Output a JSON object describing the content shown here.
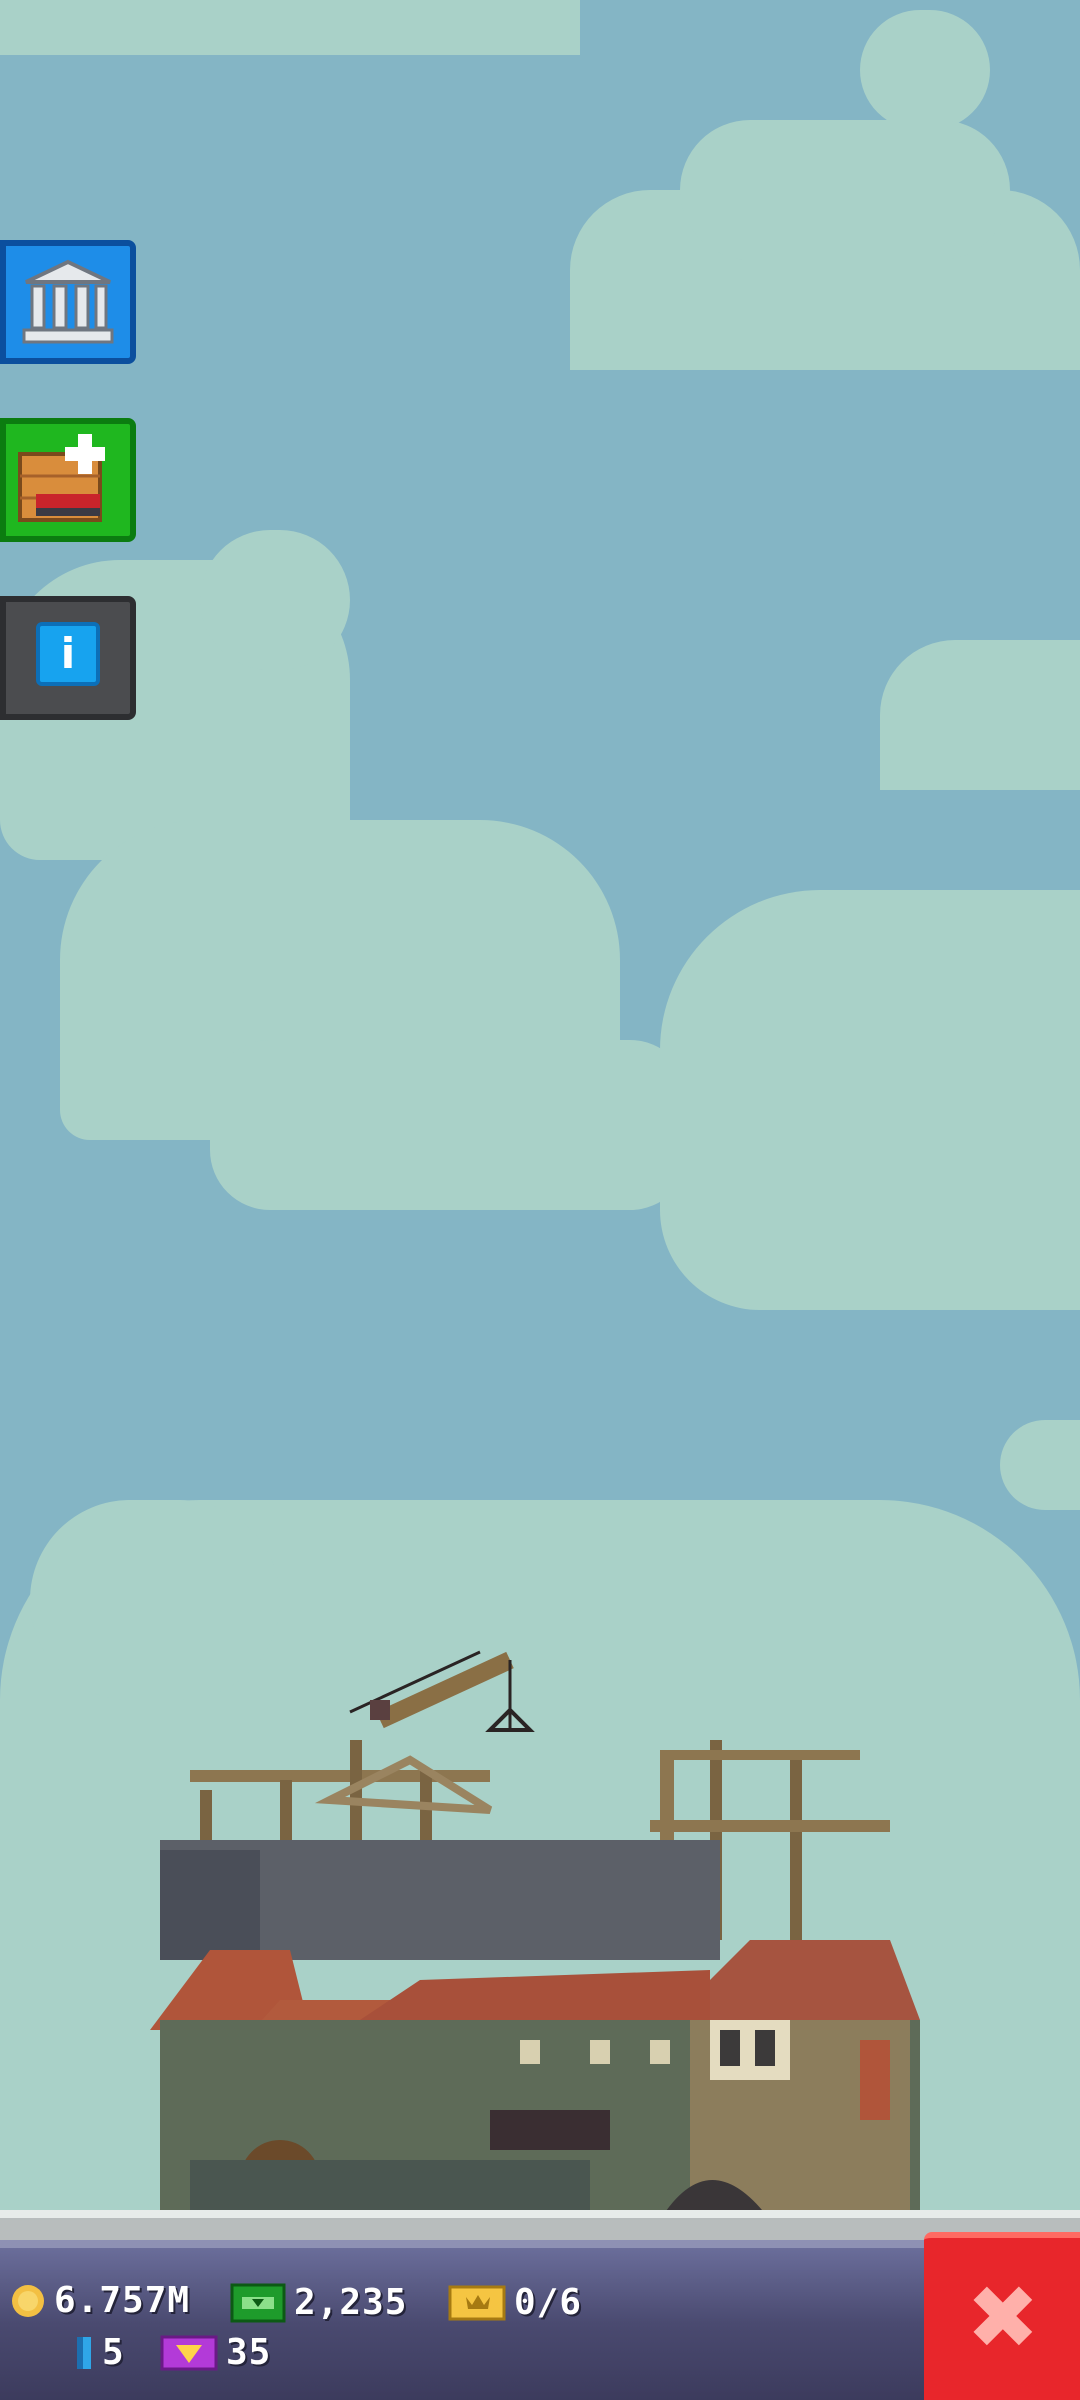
{
  "side_buttons": {
    "museum": "museum-icon",
    "add_floor": "add-floor-icon",
    "info": "info-icon",
    "info_glyph": "i"
  },
  "hud": {
    "coins": "6.757M",
    "bux": "2,235",
    "tickets": "0/6",
    "keys": "5",
    "vip": "35"
  },
  "close_button": {
    "icon": "close-icon",
    "glyph": "✖"
  },
  "colors": {
    "sky": "#84b5c5",
    "cloud": "#a9d1c8",
    "hud": "#4a4a70",
    "close": "#e8262b"
  }
}
